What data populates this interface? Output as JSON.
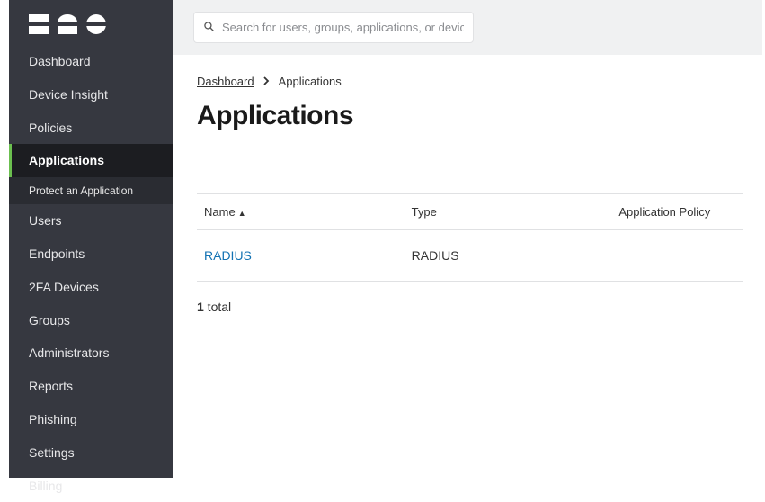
{
  "brand": "DUO",
  "search": {
    "placeholder": "Search for users, groups, applications, or devices"
  },
  "sidebar": {
    "items": [
      {
        "label": "Dashboard"
      },
      {
        "label": "Device Insight"
      },
      {
        "label": "Policies"
      },
      {
        "label": "Applications"
      },
      {
        "label": "Users"
      },
      {
        "label": "Endpoints"
      },
      {
        "label": "2FA Devices"
      },
      {
        "label": "Groups"
      },
      {
        "label": "Administrators"
      },
      {
        "label": "Reports"
      },
      {
        "label": "Phishing"
      },
      {
        "label": "Settings"
      },
      {
        "label": "Billing"
      }
    ],
    "active_sub": "Protect an Application"
  },
  "breadcrumb": {
    "root": "Dashboard",
    "current": "Applications"
  },
  "page_title": "Applications",
  "columns": {
    "name": "Name",
    "type": "Type",
    "policy": "Application Policy"
  },
  "rows": [
    {
      "name": "RADIUS",
      "type": "RADIUS",
      "policy": ""
    }
  ],
  "total_count": "1",
  "total_label": " total"
}
